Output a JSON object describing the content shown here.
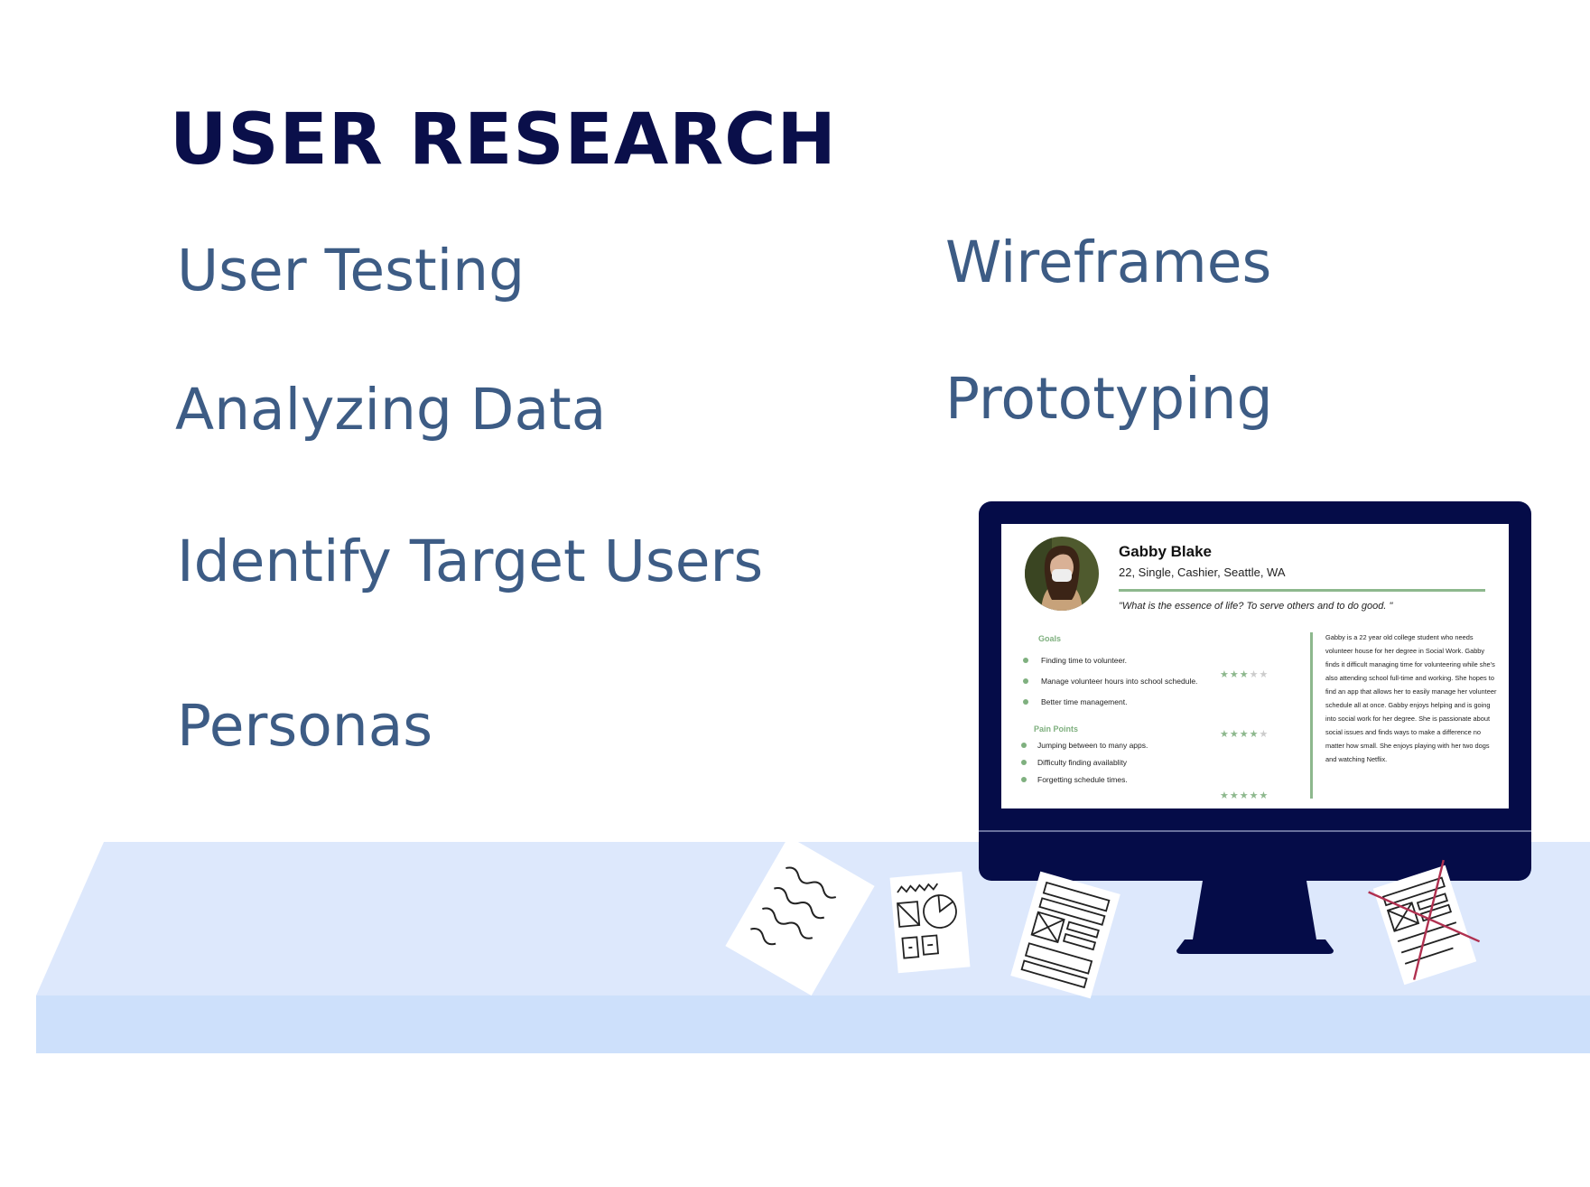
{
  "title": "USER RESEARCH",
  "skills": [
    "User Testing",
    "Analyzing Data",
    "Identify Target Users",
    "Personas",
    "Wireframes",
    "Prototyping"
  ],
  "persona": {
    "name": "Gabby Blake",
    "info": "22, Single, Cashier, Seattle, WA",
    "quote": "\"What is the essence of life? To serve others and to do good. \"",
    "goals_heading": "Goals",
    "goals": [
      "Finding time to volunteer.",
      "Manage volunteer hours into school schedule.",
      "Better time management."
    ],
    "pain_heading": "Pain Points",
    "pain_points": [
      "Jumping between to many apps.",
      "Difficulty finding availablity",
      "Forgetting schedule times."
    ],
    "ratings": [
      {
        "value": 3,
        "max": 5
      },
      {
        "value": 4,
        "max": 5
      },
      {
        "value": 5,
        "max": 5
      }
    ],
    "bio": "Gabby is a 22 year old college student who needs volunteer house for her degree in Social Work. Gabby finds it difficult managing time for volunteering while she's also attending school full-time and working. She hopes to find an app that allows her to easily  manage her volunteer schedule all at once. Gabby enjoys helping and is going into social work for her degree. She is passionate about social issues and finds ways to make a difference no matter how small. She enjoys playing with her two dogs and watching Netflix."
  },
  "colors": {
    "title": "#0a0f4a",
    "skill_text": "#3d5c85",
    "monitor": "#050c48",
    "desk_top": "#dde8fc",
    "desk_front": "#cde0fb",
    "accent_green": "#8db88d",
    "cross_red": "#b03050"
  },
  "icons": [
    "computer-monitor-icon",
    "paper-sketch-icon",
    "paper-chart-sketch-icon",
    "paper-wireframe-icon",
    "paper-crossed-wireframe-icon"
  ]
}
